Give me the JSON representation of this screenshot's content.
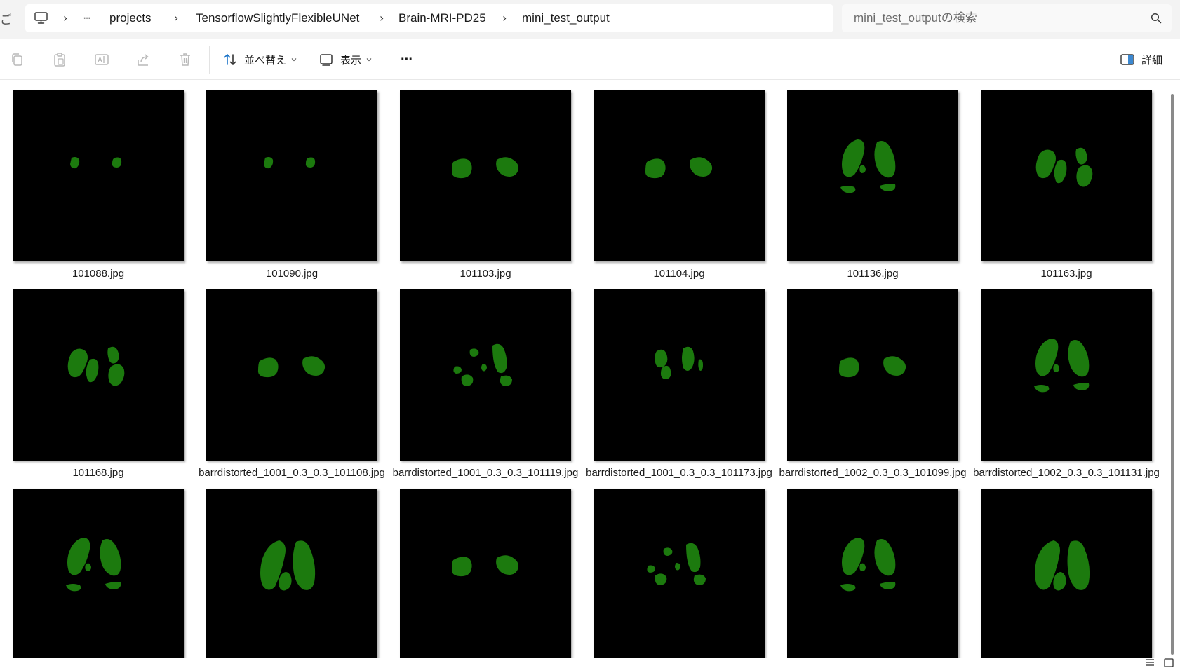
{
  "window": {
    "left_glyph": "ご"
  },
  "breadcrumb": {
    "overflow_label": "···",
    "items": [
      "projects",
      "TensorflowSlightlyFlexibleUNet",
      "Brain-MRI-PD25",
      "mini_test_output"
    ]
  },
  "search": {
    "placeholder": "mini_test_outputの検索",
    "value": ""
  },
  "toolbar": {
    "sort_label": "並べ替え",
    "view_label": "表示",
    "more_label": "···",
    "details_label": "詳細"
  },
  "files": [
    {
      "name": "101088.jpg",
      "pattern": "small-dots"
    },
    {
      "name": "101090.jpg",
      "pattern": "small-dots"
    },
    {
      "name": "101103.jpg",
      "pattern": "two-blobs"
    },
    {
      "name": "101104.jpg",
      "pattern": "two-blobs"
    },
    {
      "name": "101136.jpg",
      "pattern": "large-spread"
    },
    {
      "name": "101163.jpg",
      "pattern": "four-blobs"
    },
    {
      "name": "101168.jpg",
      "pattern": "four-blobs"
    },
    {
      "name": "barrdistorted_1001_0.3_0.3_101108.jpg",
      "pattern": "two-blobs"
    },
    {
      "name": "barrdistorted_1001_0.3_0.3_101119.jpg",
      "pattern": "scattered"
    },
    {
      "name": "barrdistorted_1001_0.3_0.3_101173.jpg",
      "pattern": "four-blobs-small"
    },
    {
      "name": "barrdistorted_1002_0.3_0.3_101099.jpg",
      "pattern": "two-blobs"
    },
    {
      "name": "barrdistorted_1002_0.3_0.3_101131.jpg",
      "pattern": "large-spread"
    },
    {
      "name": "",
      "pattern": "large-spread"
    },
    {
      "name": "",
      "pattern": "large-pair"
    },
    {
      "name": "",
      "pattern": "two-blobs"
    },
    {
      "name": "",
      "pattern": "scattered"
    },
    {
      "name": "",
      "pattern": "large-spread"
    },
    {
      "name": "",
      "pattern": "large-pair"
    }
  ],
  "colors": {
    "mask_green": "#1c7a0e",
    "thumbnail_bg": "#000000",
    "accent_blue": "#1a73c8"
  }
}
